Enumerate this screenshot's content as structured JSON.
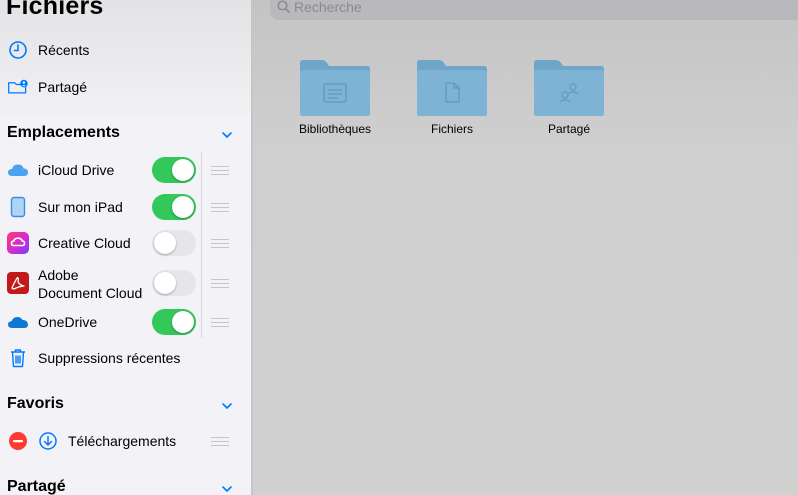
{
  "app": {
    "title": "Fichiers"
  },
  "search": {
    "placeholder": "Recherche"
  },
  "top_items": [
    {
      "label": "Récents",
      "icon": "clock-icon"
    },
    {
      "label": "Partagé",
      "icon": "shared-folder-icon"
    }
  ],
  "sections": {
    "locations": {
      "title": "Emplacements",
      "items": [
        {
          "label": "iCloud Drive",
          "enabled": true,
          "icon": "icloud-icon"
        },
        {
          "label": "Sur mon iPad",
          "enabled": true,
          "icon": "ipad-icon"
        },
        {
          "label": "Creative Cloud",
          "enabled": false,
          "icon": "creative-cloud-icon"
        },
        {
          "label": "Adobe",
          "label2": "Document Cloud",
          "enabled": false,
          "icon": "adobe-acrobat-icon"
        },
        {
          "label": "OneDrive",
          "enabled": true,
          "icon": "onedrive-icon"
        }
      ],
      "recently_deleted": "Suppressions récentes"
    },
    "favorites": {
      "title": "Favoris",
      "items": [
        {
          "label": "Téléchargements",
          "icon": "download-icon"
        }
      ]
    },
    "shared": {
      "title": "Partagé"
    }
  },
  "folders": [
    {
      "name": "Bibliothèques",
      "icon": "library-folder-icon"
    },
    {
      "name": "Fichiers",
      "icon": "document-folder-icon"
    },
    {
      "name": "Partagé",
      "icon": "shared-folder-icon"
    }
  ],
  "colors": {
    "accent": "#007aff",
    "toggle_on": "#34c759",
    "toggle_off": "#e5e5ea",
    "folder": "#7eb3d6",
    "delete": "#ff3b30"
  }
}
